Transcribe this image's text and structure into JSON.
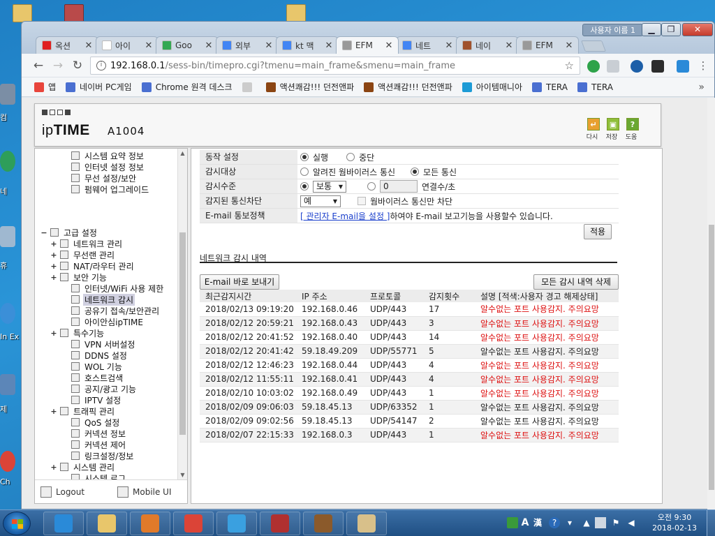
{
  "desktop": {
    "left_labels": [
      "컴",
      "네",
      "휴",
      "In Ex",
      "제",
      "Ch"
    ]
  },
  "window": {
    "user_label": "사용자 이름 1",
    "controls": {
      "minimize": "▁",
      "maximize": "❐",
      "close": "✕"
    }
  },
  "tabs": [
    {
      "title": "옥션",
      "color": "#e02020",
      "active": false
    },
    {
      "title": "아이",
      "color": "#ffffff",
      "active": false
    },
    {
      "title": "Goo",
      "color": "#34a853",
      "active": false
    },
    {
      "title": "외부",
      "color": "#4285f4",
      "active": false
    },
    {
      "title": "kt 맥",
      "color": "#4285f4",
      "active": false
    },
    {
      "title": "EFM",
      "color": "#999999",
      "active": true
    },
    {
      "title": "네트",
      "color": "#4285f4",
      "active": false
    },
    {
      "title": "네이",
      "color": "#a0522d",
      "active": false
    },
    {
      "title": "EFM",
      "color": "#999999",
      "active": false
    }
  ],
  "tab_close_glyph": "✕",
  "addressbar": {
    "host": "192.168.0.1",
    "path": "/sess-bin/timepro.cgi?tmenu=main_frame&smenu=main_frame",
    "info_glyph": "i",
    "star_glyph": "☆",
    "back_glyph": "←",
    "forward_glyph": "→",
    "reload_glyph": "↻"
  },
  "bookmarks": [
    {
      "label": "앱",
      "color": "#e8453c"
    },
    {
      "label": "네이버 PC게임",
      "color": "#4a6fd1"
    },
    {
      "label": "Chrome 원격 데스크",
      "color": "#4a6fd1"
    },
    {
      "label": "",
      "color": "#cccccc"
    },
    {
      "label": "액션쾌감!!! 던전앤파",
      "color": "#8b4513"
    },
    {
      "label": "액션쾌감!!! 던전앤파",
      "color": "#8b4513"
    },
    {
      "label": "아이템매니아",
      "color": "#1c9bd6"
    },
    {
      "label": "TERA",
      "color": "#4a6fd1"
    },
    {
      "label": "TERA",
      "color": "#4a6fd1"
    }
  ],
  "bookmarks_more": "»",
  "router": {
    "brand_ip": "ip",
    "brand_time": "TIME",
    "model": "A1004",
    "header_buttons": [
      {
        "label": "다시",
        "glyph": "↵",
        "color": "#e8a030"
      },
      {
        "label": "저장",
        "glyph": "▣",
        "color": "#8fbf3a"
      },
      {
        "label": "도움",
        "glyph": "?",
        "color": "#6aa832"
      }
    ]
  },
  "tree": [
    {
      "label": "시스템 요약 정보",
      "indent": 2,
      "plus": false,
      "selected": false
    },
    {
      "label": "인터넷 설정 정보",
      "indent": 2,
      "plus": false,
      "selected": false
    },
    {
      "label": "무선 설정/보안",
      "indent": 2,
      "plus": false,
      "selected": false
    },
    {
      "label": "펌웨어 업그레이드",
      "indent": 2,
      "plus": false,
      "selected": false
    },
    {
      "label": "고급 설정",
      "indent": 0,
      "plus": true,
      "selected": false,
      "gap": true
    },
    {
      "label": "네트워크 관리",
      "indent": 1,
      "plus": true,
      "selected": false
    },
    {
      "label": "무선랜 관리",
      "indent": 1,
      "plus": true,
      "selected": false
    },
    {
      "label": "NAT/라우터 관리",
      "indent": 1,
      "plus": true,
      "selected": false
    },
    {
      "label": "보안 기능",
      "indent": 1,
      "plus": true,
      "selected": false
    },
    {
      "label": "인터넷/WiFi 사용 제한",
      "indent": 2,
      "plus": false,
      "selected": false
    },
    {
      "label": "네트워크 감시",
      "indent": 2,
      "plus": false,
      "selected": true
    },
    {
      "label": "공유기 접속/보안관리",
      "indent": 2,
      "plus": false,
      "selected": false
    },
    {
      "label": "아이안심ipTIME",
      "indent": 2,
      "plus": false,
      "selected": false
    },
    {
      "label": "특수기능",
      "indent": 1,
      "plus": true,
      "selected": false
    },
    {
      "label": "VPN 서버설정",
      "indent": 2,
      "plus": false,
      "selected": false
    },
    {
      "label": "DDNS 설정",
      "indent": 2,
      "plus": false,
      "selected": false
    },
    {
      "label": "WOL 기능",
      "indent": 2,
      "plus": false,
      "selected": false
    },
    {
      "label": "호스트검색",
      "indent": 2,
      "plus": false,
      "selected": false
    },
    {
      "label": "공지/광고 기능",
      "indent": 2,
      "plus": false,
      "selected": false
    },
    {
      "label": "IPTV 설정",
      "indent": 2,
      "plus": false,
      "selected": false
    },
    {
      "label": "트래픽 관리",
      "indent": 1,
      "plus": true,
      "selected": false
    },
    {
      "label": "QoS 설정",
      "indent": 2,
      "plus": false,
      "selected": false
    },
    {
      "label": "커넥션 정보",
      "indent": 2,
      "plus": false,
      "selected": false
    },
    {
      "label": "커넥션 제어",
      "indent": 2,
      "plus": false,
      "selected": false
    },
    {
      "label": "링크설정/정보",
      "indent": 2,
      "plus": false,
      "selected": false
    },
    {
      "label": "시스템 관리",
      "indent": 1,
      "plus": true,
      "selected": false
    },
    {
      "label": "시스템 로그",
      "indent": 2,
      "plus": false,
      "selected": false
    }
  ],
  "leftfoot": {
    "logout": "Logout",
    "mobile": "Mobile UI"
  },
  "settings": {
    "op_label": "동작 설정",
    "op_run": "실행",
    "op_stop": "중단",
    "target_label": "감시대상",
    "target_known": "알려진 웜바이러스 통신",
    "target_all": "모든 통신",
    "level_label": "감시수준",
    "level_select": "보통",
    "level_count": "0",
    "level_unit": "연결수/초",
    "block_label": "감지된 통신차단",
    "block_select": "예",
    "block_worm_only": "웜바이러스 통신만 차단",
    "email_label": "E-mail 통보정책",
    "email_link": "[ 관리자 E-mail을 설정 ]",
    "email_text": "하여야 E-mail 보고기능을 사용할수 있습니다.",
    "apply": "적용"
  },
  "log": {
    "title": "네트워크 감시 내역",
    "send_email": "E-mail 바로 보내기",
    "delete_all": "모든 감시 내역 삭제",
    "columns": [
      "최근감지시간",
      "IP 주소",
      "프로토콜",
      "감지횟수",
      "설명 [적색:사용자 경고 해제상태]"
    ],
    "rows": [
      {
        "time": "2018/02/13 09:19:20",
        "ip": "192.168.0.46",
        "proto": "UDP/443",
        "count": "17",
        "desc": "알수없는 포트 사용감지. 주의요망",
        "red": true
      },
      {
        "time": "2018/02/12 20:59:21",
        "ip": "192.168.0.43",
        "proto": "UDP/443",
        "count": "3",
        "desc": "알수없는 포트 사용감지. 주의요망",
        "red": true
      },
      {
        "time": "2018/02/12 20:41:52",
        "ip": "192.168.0.40",
        "proto": "UDP/443",
        "count": "14",
        "desc": "알수없는 포트 사용감지. 주의요망",
        "red": true
      },
      {
        "time": "2018/02/12 20:41:42",
        "ip": "59.18.49.209",
        "proto": "UDP/55771",
        "count": "5",
        "desc": "알수없는 포트 사용감지. 주의요망",
        "red": false
      },
      {
        "time": "2018/02/12 12:46:23",
        "ip": "192.168.0.44",
        "proto": "UDP/443",
        "count": "4",
        "desc": "알수없는 포트 사용감지. 주의요망",
        "red": true
      },
      {
        "time": "2018/02/12 11:55:11",
        "ip": "192.168.0.41",
        "proto": "UDP/443",
        "count": "4",
        "desc": "알수없는 포트 사용감지. 주의요망",
        "red": true
      },
      {
        "time": "2018/02/10 10:03:02",
        "ip": "192.168.0.49",
        "proto": "UDP/443",
        "count": "1",
        "desc": "알수없는 포트 사용감지. 주의요망",
        "red": true
      },
      {
        "time": "2018/02/09 09:06:03",
        "ip": "59.18.45.13",
        "proto": "UDP/63352",
        "count": "1",
        "desc": "알수없는 포트 사용감지. 주의요망",
        "red": false
      },
      {
        "time": "2018/02/09 09:02:56",
        "ip": "59.18.45.13",
        "proto": "UDP/54147",
        "count": "2",
        "desc": "알수없는 포트 사용감지. 주의요망",
        "red": false
      },
      {
        "time": "2018/02/07 22:15:33",
        "ip": "192.168.0.3",
        "proto": "UDP/443",
        "count": "1",
        "desc": "알수없는 포트 사용감지. 주의요망",
        "red": true
      }
    ]
  },
  "taskbar": {
    "items": [
      {
        "name": "ie",
        "color": "#2a8ad8"
      },
      {
        "name": "explorer",
        "color": "#e8c66b"
      },
      {
        "name": "media",
        "color": "#e07a2a"
      },
      {
        "name": "chrome",
        "color": "#db4437"
      },
      {
        "name": "dolphin",
        "color": "#3aa0e0"
      },
      {
        "name": "id",
        "color": "#b03030"
      },
      {
        "name": "game",
        "color": "#8b5a2b"
      },
      {
        "name": "paint",
        "color": "#d8c08a"
      }
    ],
    "ime_a": "A",
    "ime_han": "漢",
    "time": "오전 9:30",
    "date": "2018-02-13"
  }
}
